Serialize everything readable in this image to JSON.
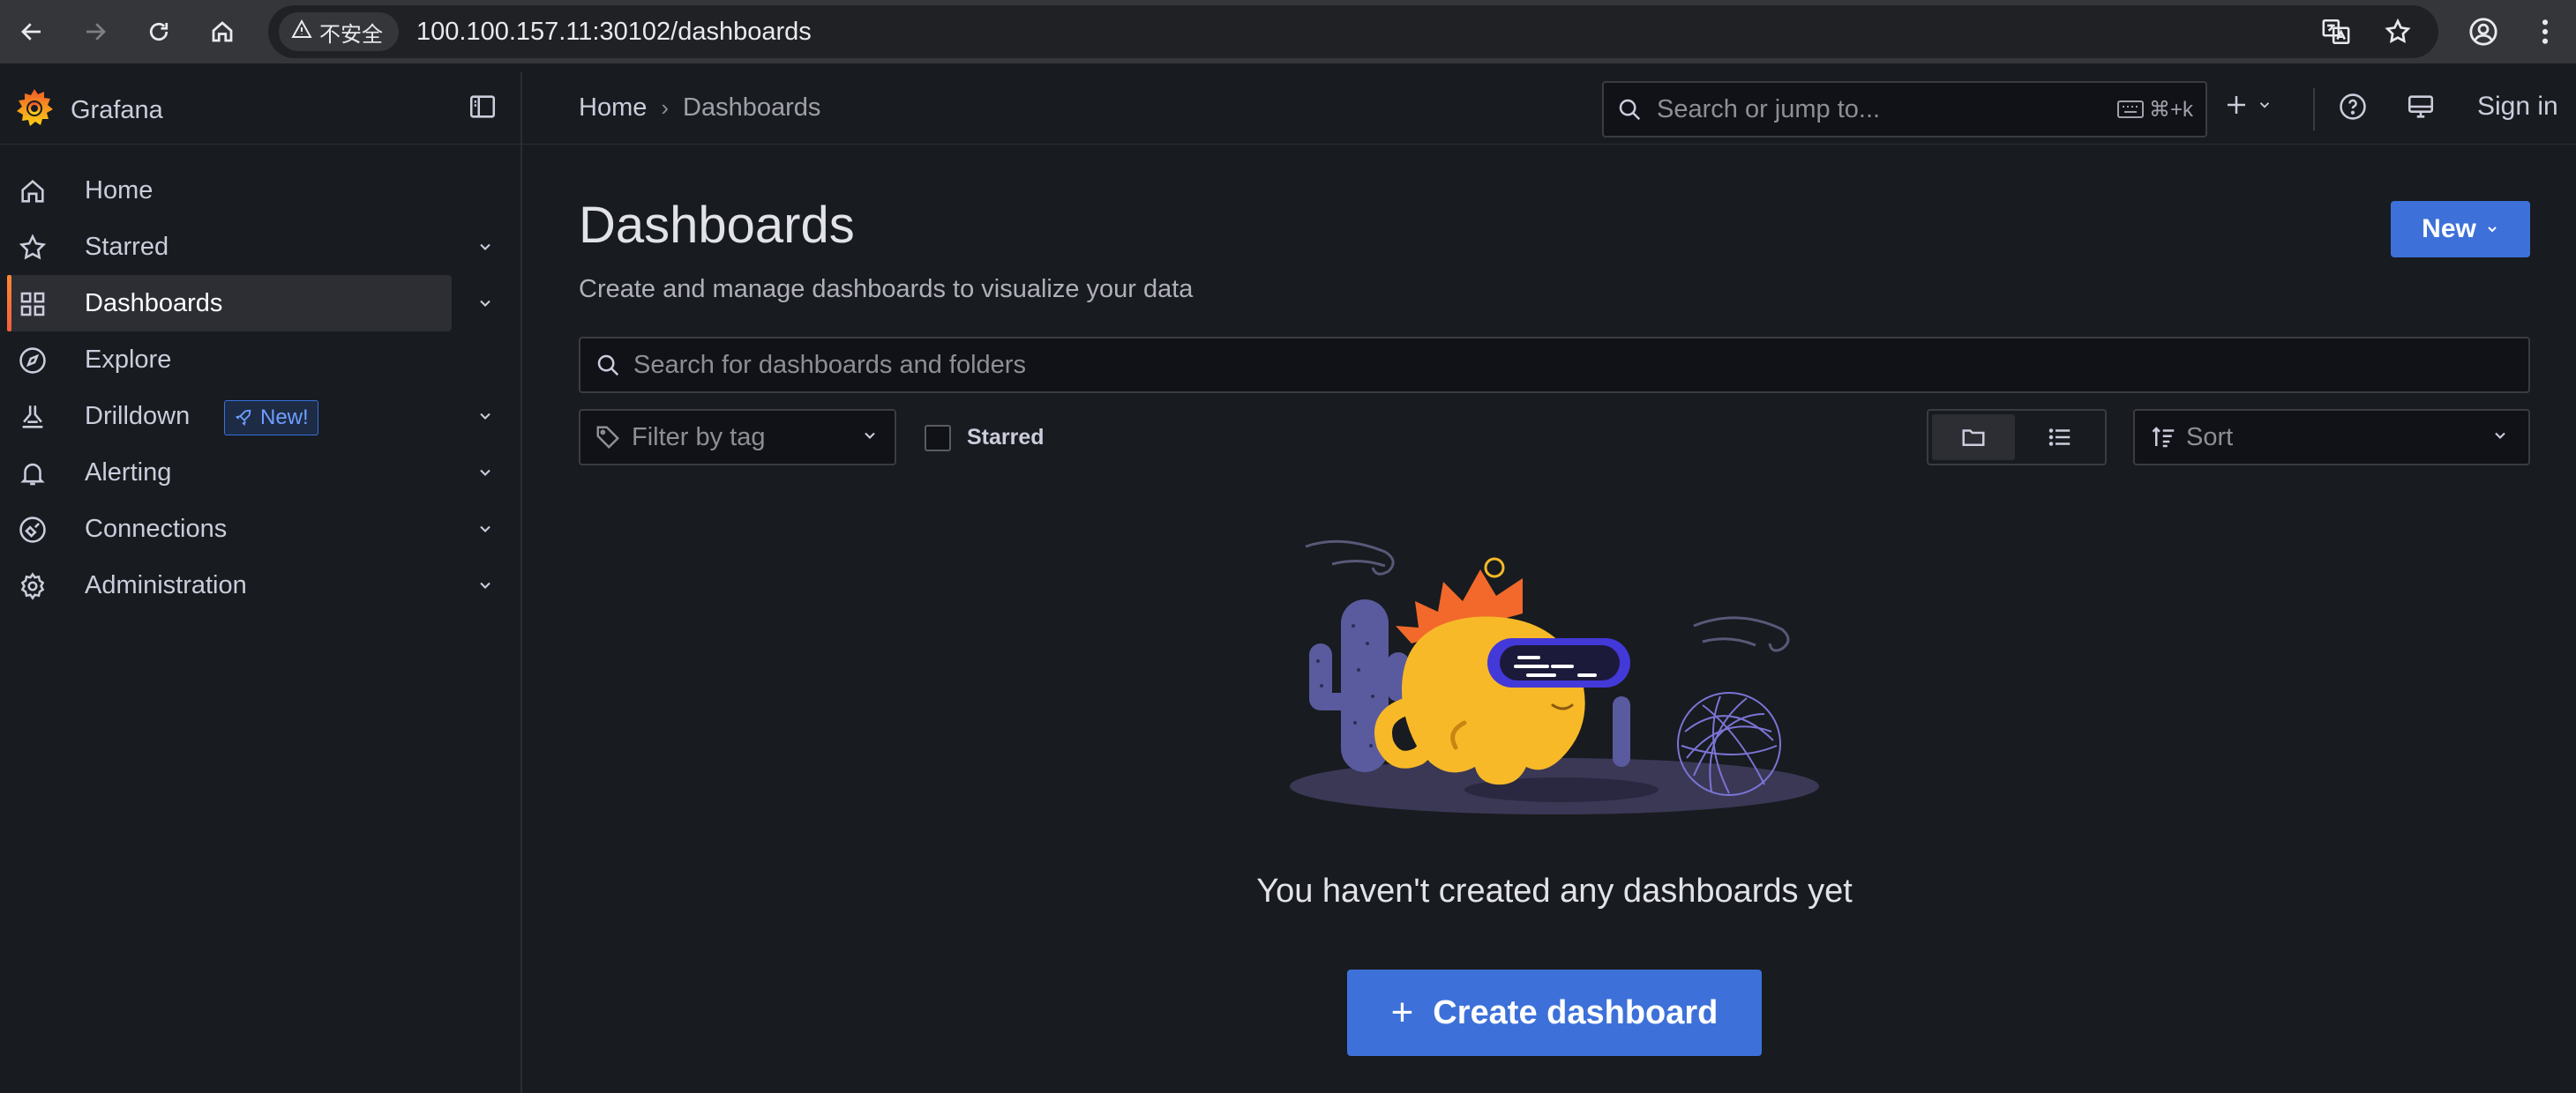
{
  "browser": {
    "security_label": "不安全",
    "url": "100.100.157.11:30102/dashboards"
  },
  "app": {
    "name": "Grafana",
    "brand_color": "#f46800"
  },
  "topbar": {
    "breadcrumb": [
      "Home",
      "Dashboards"
    ],
    "search_placeholder": "Search or jump to...",
    "search_shortcut": "⌘+k",
    "sign_in": "Sign in"
  },
  "sidebar": {
    "items": [
      {
        "label": "Home",
        "icon": "home-icon",
        "expandable": false,
        "active": false
      },
      {
        "label": "Starred",
        "icon": "star-icon",
        "expandable": true,
        "active": false
      },
      {
        "label": "Dashboards",
        "icon": "apps-icon",
        "expandable": true,
        "active": true
      },
      {
        "label": "Explore",
        "icon": "compass-icon",
        "expandable": false,
        "active": false
      },
      {
        "label": "Drilldown",
        "icon": "drilldown-icon",
        "expandable": true,
        "active": false,
        "badge": "New!"
      },
      {
        "label": "Alerting",
        "icon": "bell-icon",
        "expandable": true,
        "active": false
      },
      {
        "label": "Connections",
        "icon": "connections-icon",
        "expandable": true,
        "active": false
      },
      {
        "label": "Administration",
        "icon": "cog-icon",
        "expandable": true,
        "active": false
      }
    ]
  },
  "main": {
    "title": "Dashboards",
    "subtitle": "Create and manage dashboards to visualize your data",
    "new_button": "New",
    "search_placeholder": "Search for dashboards and folders",
    "tag_filter_placeholder": "Filter by tag",
    "starred_label": "Starred",
    "starred_checked": false,
    "view_mode": "folders",
    "sort_placeholder": "Sort",
    "empty_message": "You haven't created any dashboards yet",
    "create_button": "Create dashboard",
    "primary_color": "#3d71d9"
  }
}
